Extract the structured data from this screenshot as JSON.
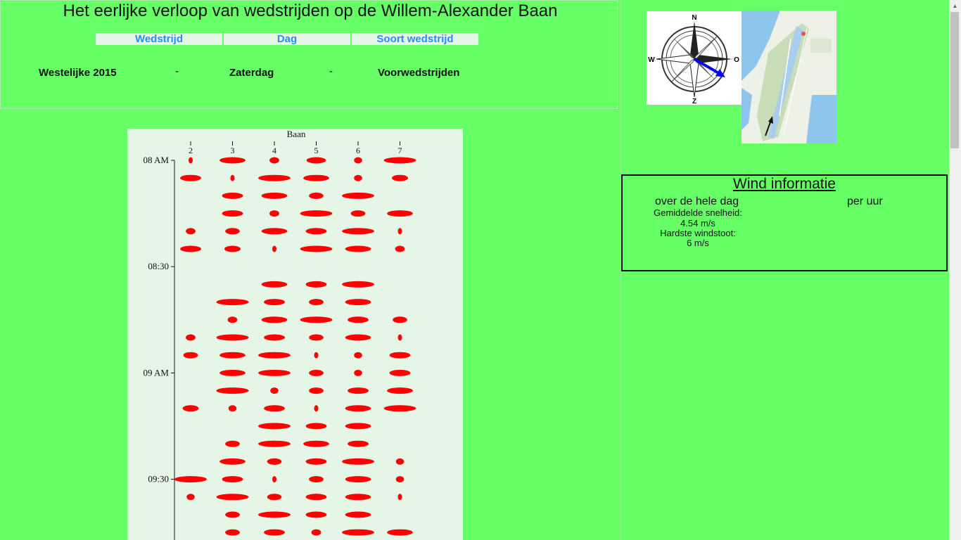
{
  "page": {
    "title": "Het eerlijke verloop van wedstrijden op de Willem-Alexander Baan"
  },
  "menu": {
    "wedstrijd": "Wedstrijd",
    "dag": "Dag",
    "soort": "Soort wedstrijd"
  },
  "selection": {
    "wedstrijd": "Westelijke 2015",
    "dag": "Zaterdag",
    "soort": "Voorwedstrijden",
    "separator": "-"
  },
  "compass": {
    "north": "N",
    "east": "O",
    "south": "Z",
    "west": "W"
  },
  "wind": {
    "title": "Wind informatie",
    "whole_day": "over de hele dag",
    "per_hour": "per uur",
    "avg_label": "Gemiddelde snelheid:",
    "avg_value": "4.54 m/s",
    "gust_label": "Hardste windstoot:",
    "gust_value": "6 m/s"
  },
  "colors": {
    "background": "#66ff66",
    "panel": "#e6f6e6",
    "menu_text": "#2a8cf0",
    "marker": "#ff0000",
    "wind_arrow": "#0000ff"
  },
  "chart_data": {
    "type": "scatter",
    "title": "Baan",
    "x_ticks": [
      "2",
      "3",
      "4",
      "5",
      "6",
      "7"
    ],
    "y_ticks": [
      "08 AM",
      "08:30",
      "09 AM",
      "09:30"
    ],
    "marker_shape": "ellipse",
    "note_width": "horizontal width of each ellipse is a relative magnitude 0-1",
    "rows": [
      [
        0.1,
        0.8,
        0.3,
        0.6,
        0.25,
        1.0
      ],
      [
        0.65,
        0.1,
        1.0,
        0.8,
        0.25,
        0.5
      ],
      [
        null,
        0.65,
        0.8,
        0.45,
        1.0,
        null
      ],
      [
        null,
        0.65,
        0.3,
        1.0,
        0.45,
        0.8
      ],
      [
        0.3,
        0.45,
        0.8,
        0.65,
        1.0,
        0.1
      ],
      [
        0.65,
        0.5,
        0.1,
        1.0,
        0.8,
        0.3
      ],
      [
        null,
        null,
        null,
        null,
        null,
        null
      ],
      [
        null,
        null,
        0.8,
        0.65,
        1.0,
        null
      ],
      [
        null,
        1.0,
        0.65,
        0.45,
        0.8,
        null
      ],
      [
        null,
        0.3,
        0.8,
        1.0,
        0.65,
        0.45
      ],
      [
        0.3,
        1.0,
        0.65,
        0.45,
        0.8,
        0.1
      ],
      [
        0.45,
        0.8,
        1.0,
        0.1,
        0.25,
        0.65
      ],
      [
        null,
        0.8,
        1.0,
        0.45,
        0.25,
        0.65
      ],
      [
        null,
        1.0,
        0.25,
        0.45,
        0.65,
        0.8
      ],
      [
        0.5,
        0.25,
        0.65,
        0.1,
        0.8,
        1.0
      ],
      [
        null,
        null,
        1.0,
        0.65,
        0.8,
        null
      ],
      [
        null,
        0.45,
        1.0,
        0.8,
        0.65,
        null
      ],
      [
        null,
        0.8,
        0.45,
        0.65,
        1.0,
        0.25
      ],
      [
        1.0,
        0.65,
        0.1,
        0.45,
        0.8,
        0.25
      ],
      [
        0.25,
        1.0,
        0.45,
        0.65,
        0.8,
        0.1
      ],
      [
        null,
        0.45,
        1.0,
        0.65,
        0.8,
        null
      ],
      [
        null,
        0.45,
        0.65,
        0.3,
        1.0,
        0.8
      ]
    ]
  }
}
